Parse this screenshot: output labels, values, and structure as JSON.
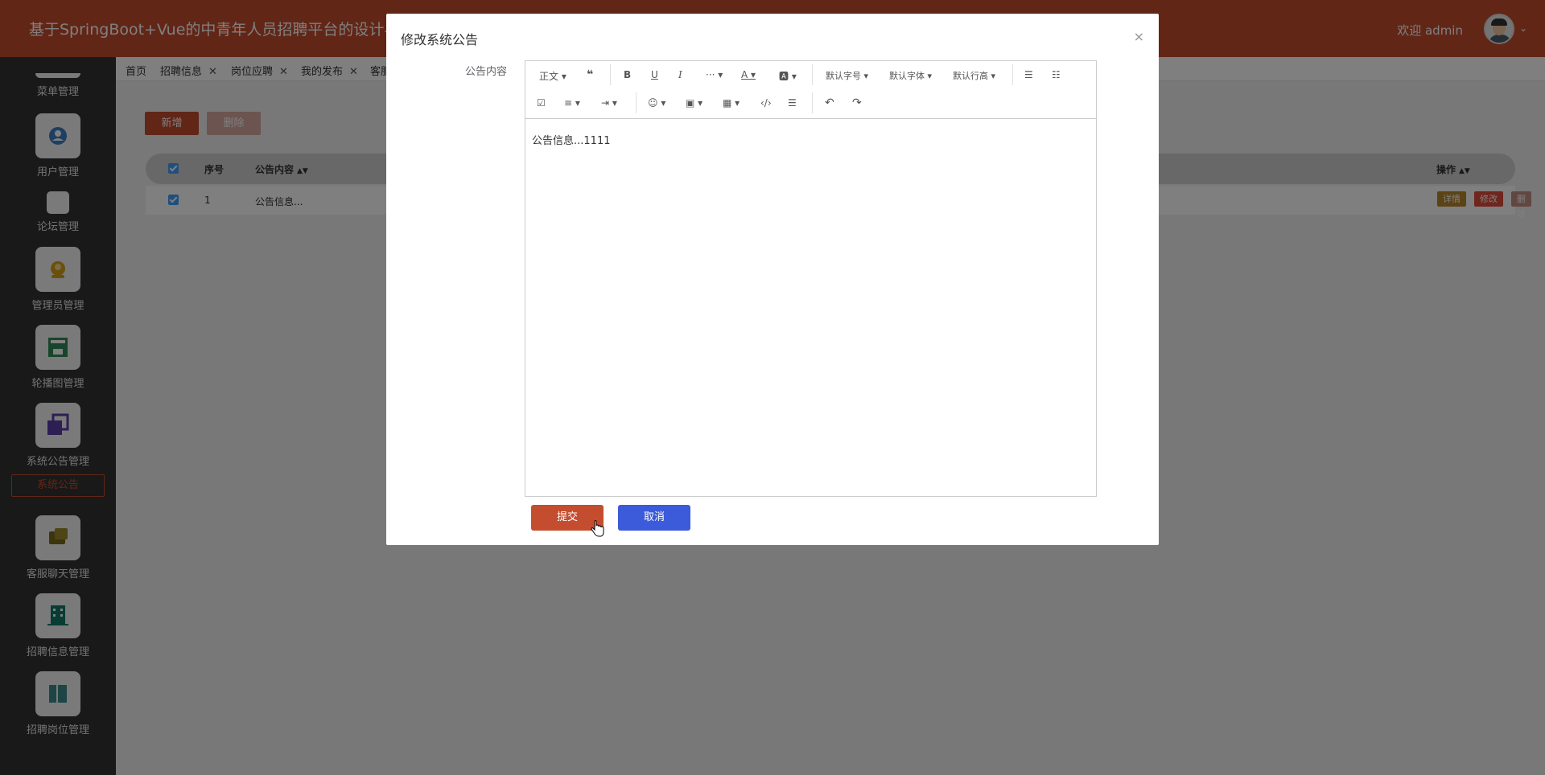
{
  "header": {
    "title": "基于SpringBoot+Vue的中青年人员招聘平台的设计与实现",
    "welcome": "欢迎 admin",
    "caret": "⌄"
  },
  "sidebar": {
    "items": [
      {
        "label": "菜单管理",
        "icon": "menu-icon"
      },
      {
        "label": "用户管理",
        "icon": "user-icon",
        "color": "#3b7fc4"
      },
      {
        "label": "论坛管理",
        "icon": "forum-icon"
      },
      {
        "label": "管理员管理",
        "icon": "admin-icon",
        "color": "#d4a017"
      },
      {
        "label": "轮播图管理",
        "icon": "carousel-icon",
        "color": "#2e8b57"
      },
      {
        "label": "系统公告管理",
        "icon": "notice-icon",
        "color": "#5b3fa8"
      },
      {
        "label": "客服聊天管理",
        "icon": "chat-icon",
        "color": "#7a6a1a"
      },
      {
        "label": "招聘信息管理",
        "icon": "building-icon",
        "color": "#0e7a6a"
      },
      {
        "label": "招聘岗位管理",
        "icon": "book-icon",
        "color": "#3a8a8a"
      }
    ],
    "active_sub": "系统公告"
  },
  "tabs": [
    {
      "label": "首页",
      "closable": false
    },
    {
      "label": "招聘信息",
      "closable": true
    },
    {
      "label": "岗位应聘",
      "closable": true
    },
    {
      "label": "我的发布",
      "closable": true
    },
    {
      "label": "客服",
      "closable": false
    }
  ],
  "toolbar": {
    "add_label": "新增",
    "delete_label": "删除"
  },
  "table": {
    "headers": {
      "index": "序号",
      "content": "公告内容",
      "actions": "操作"
    },
    "rows": [
      {
        "index": "1",
        "content": "公告信息..."
      }
    ],
    "row_actions": {
      "detail": "详情",
      "edit": "修改",
      "delete": "删除"
    }
  },
  "dialog": {
    "title": "修改系统公告",
    "close": "×",
    "field_label": "公告内容",
    "editor_content": "公告信息...1111",
    "submit_label": "提交",
    "cancel_label": "取消",
    "editor_toolbar": {
      "paragraph": "正文",
      "font_size": "默认字号",
      "font_family": "默认字体",
      "line_height": "默认行高",
      "more": "···"
    }
  },
  "colors": {
    "brand": "#c54d2f",
    "sidebar_bg": "#333333",
    "cancel": "#3b5bdb",
    "checkbox": "#409eff"
  }
}
